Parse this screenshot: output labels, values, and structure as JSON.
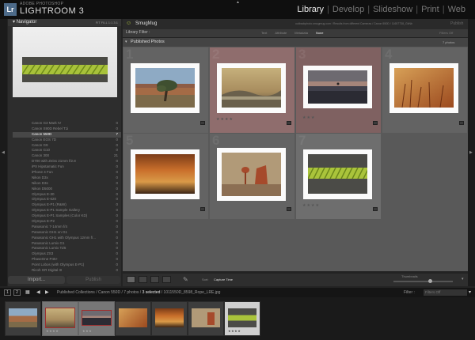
{
  "app": {
    "brand_small": "ADOBE PHOTOSHOP",
    "brand_big": "LIGHTROOM 3",
    "logo": "Lr"
  },
  "modules": [
    "Library",
    "Develop",
    "Slideshow",
    "Print",
    "Web"
  ],
  "active_module": "Library",
  "navigator": {
    "title": "Navigator",
    "zoom": "FIT   FILL   1:1   3:1"
  },
  "collections": [
    {
      "name": "Canon G3 Mark IV",
      "count": "0"
    },
    {
      "name": "Canon S90D Rebel T1i",
      "count": "0"
    },
    {
      "name": "Canon 550D",
      "count": "7",
      "selected": true
    },
    {
      "name": "Canon EOS 7D",
      "count": "0"
    },
    {
      "name": "Canon G9",
      "count": "0"
    },
    {
      "name": "Canon G10",
      "count": "0"
    },
    {
      "name": "Canon 300",
      "count": "21"
    },
    {
      "name": "D700 with Zeiss 21mm f/2.8",
      "count": "0"
    },
    {
      "name": "iPX Hipstamatic Fun",
      "count": "0"
    },
    {
      "name": "iPhone 4 Fun",
      "count": "0"
    },
    {
      "name": "Nikon D3x",
      "count": "0"
    },
    {
      "name": "Nikon D3s",
      "count": "0"
    },
    {
      "name": "Nikon D5000",
      "count": "0"
    },
    {
      "name": "Olympus E-30",
      "count": "0"
    },
    {
      "name": "Olympus E-620",
      "count": "0"
    },
    {
      "name": "Olympus E-P1 (R&W)",
      "count": "0"
    },
    {
      "name": "Olympus E-P1 Sample Gallery",
      "count": "0"
    },
    {
      "name": "Olympus E-P1 Samples (Color KD)",
      "count": "0"
    },
    {
      "name": "Olympus E-P2",
      "count": "0"
    },
    {
      "name": "Panasonic 7-14mm f/4",
      "count": "0"
    },
    {
      "name": "Panasonic GH1 on G1",
      "count": "0"
    },
    {
      "name": "Panasonic GH1 with Olympus 12mm f/...",
      "count": "0"
    },
    {
      "name": "Panasonic Lumix G1",
      "count": "0"
    },
    {
      "name": "Panasonic Lumix TZ5",
      "count": "0"
    },
    {
      "name": "Olympus ZS3",
      "count": "0"
    },
    {
      "name": "PhaseOne P45+",
      "count": "0"
    },
    {
      "name": "Point Lobos (with Olympus E-P1)",
      "count": "0"
    },
    {
      "name": "Ricoh GR Digital III",
      "count": "0"
    }
  ],
  "buttons": {
    "import": "Import...",
    "publish": "Publish"
  },
  "header": {
    "title": "SmugMug",
    "path": "outbackphoto.smugmug.com / Results from different Cameras / Canon 550D / 11657738_GkNb",
    "publish": "Publish"
  },
  "filter_bar": {
    "title": "Library Filter :",
    "options": [
      "Text",
      "Attribute",
      "Metadata",
      "None"
    ],
    "active": "None",
    "filters_off": "Filters Off"
  },
  "published": {
    "title": "Published Photos",
    "count": "7 photos"
  },
  "photos": [
    {
      "num": "1",
      "state": "normal",
      "stars": "",
      "scene": "desert-tree"
    },
    {
      "num": "2",
      "state": "selected",
      "stars": "★★★★",
      "scene": "fog-hills"
    },
    {
      "num": "3",
      "state": "selected-dim",
      "stars": "★★★",
      "scene": "dark-lake"
    },
    {
      "num": "4",
      "state": "normal",
      "stars": "",
      "scene": "orange-grass"
    },
    {
      "num": "5",
      "state": "normal",
      "stars": "",
      "scene": "orange-sky"
    },
    {
      "num": "6",
      "state": "normal",
      "stars": "",
      "scene": "balanced-rock"
    },
    {
      "num": "7",
      "state": "active",
      "stars": "★★★★",
      "scene": "rope"
    }
  ],
  "toolbar": {
    "sort_label": "Sort:",
    "sort_value": "Capture Time",
    "thumbnails_label": "Thumbnails"
  },
  "filmstrip_bar": {
    "pages": [
      "1",
      "2"
    ],
    "path_prefix": "Published Collections / Canon 550D / 7 photos /",
    "path_selected": "3 selected",
    "path_file": "/ 1011550D_8598_Rope_LRE.jpg",
    "filter_label": "Filter :",
    "filter_value": "Filters Off"
  },
  "colors": {
    "accent": "#b5cc3a",
    "selection": "#8f6d6d",
    "background": "#232323"
  }
}
